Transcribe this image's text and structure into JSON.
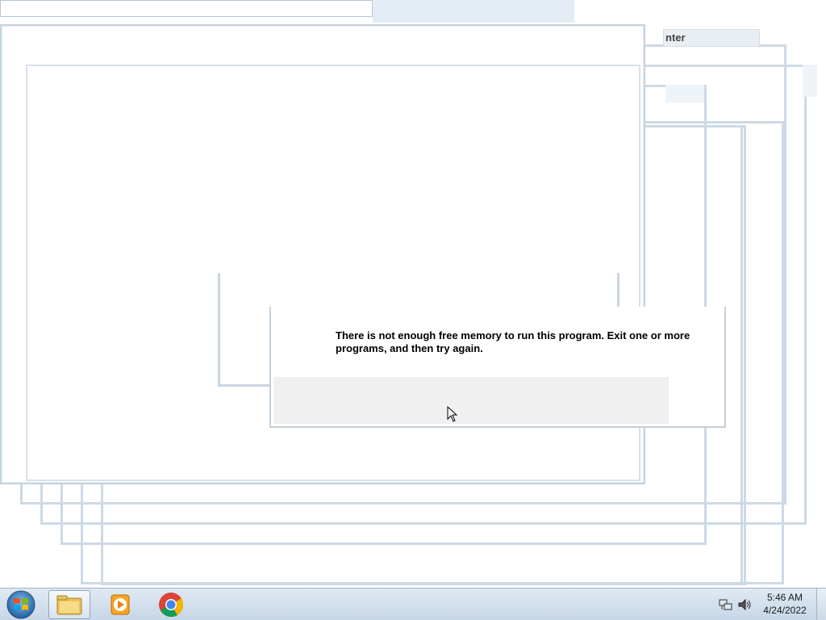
{
  "search_partial_text": "nter",
  "dialog": {
    "message": "There is not enough free memory to run this program. Exit one or more programs, and then try again."
  },
  "taskbar": {
    "start_icon": "windows-orb-icon",
    "items": [
      {
        "name": "windows-explorer",
        "icon": "folder-icon",
        "active": true
      },
      {
        "name": "media-player",
        "icon": "media-player-icon",
        "active": false
      },
      {
        "name": "chrome",
        "icon": "chrome-icon",
        "active": false
      }
    ],
    "tray": {
      "network_icon": "network-icon",
      "volume_icon": "speaker-icon"
    },
    "clock": {
      "time": "5:46 AM",
      "date": "4/24/2022"
    }
  },
  "colors": {
    "frame": "#c9d6e2",
    "taskbar_top": "#dfe9f3",
    "taskbar_bottom": "#c7d7e7",
    "dialog_button_area": "#f0f0f0"
  }
}
